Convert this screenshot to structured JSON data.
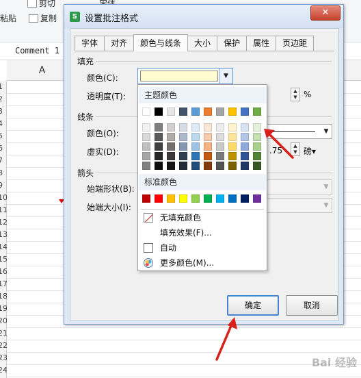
{
  "toolbar": {
    "paste_label": "粘贴",
    "copy_label": "复制",
    "cut_label": "剪切",
    "font_name": "宋体"
  },
  "formula_bar": {
    "content": "Comment 1"
  },
  "sheet": {
    "column_a": "A",
    "rows": [
      "1",
      "2",
      "3",
      "4",
      "5",
      "6",
      "7",
      "8",
      "9",
      "10",
      "11",
      "12",
      "13",
      "14",
      "15",
      "16",
      "17",
      "18",
      "19",
      "20",
      "21",
      "22",
      "23",
      "24"
    ]
  },
  "dialog": {
    "title": "设置批注格式",
    "close_symbol": "✕",
    "tabs": [
      "字体",
      "对齐",
      "颜色与线条",
      "大小",
      "保护",
      "属性",
      "页边距"
    ],
    "active_tab": "颜色与线条",
    "fill": {
      "section": "填充",
      "color_label": "颜色(C):",
      "color_value": "#fffdd0",
      "transparency_label": "透明度(T):",
      "transparency_unit": "%"
    },
    "line": {
      "section": "线条",
      "color_label": "颜色(O):",
      "dash_label": "虚实(D):",
      "weight_value": ".75",
      "weight_unit": "磅▾"
    },
    "arrows": {
      "section": "箭头",
      "begin_style_label": "始端形状(B):",
      "begin_size_label": "始端大小(I):"
    },
    "ok_label": "确定",
    "cancel_label": "取消"
  },
  "color_dropdown": {
    "theme_header": "主题颜色",
    "standard_header": "标准颜色",
    "theme_top_row": [
      "#ffffff",
      "#000000",
      "#e7e6e6",
      "#44546a",
      "#5b9bd5",
      "#ed7d31",
      "#a5a5a5",
      "#ffc000",
      "#4472c4",
      "#70ad47"
    ],
    "theme_shades": [
      [
        "#f2f2f2",
        "#808080",
        "#d0cece",
        "#d6dce4",
        "#deebf6",
        "#fbe5d5",
        "#ededed",
        "#fff2cc",
        "#d9e2f3",
        "#e2efd9"
      ],
      [
        "#d9d9d9",
        "#595959",
        "#aeaaaa",
        "#adb9ca",
        "#bdd7ee",
        "#f7cbac",
        "#dbdbdb",
        "#fee599",
        "#b4c6e7",
        "#c5e0b3"
      ],
      [
        "#bfbfbf",
        "#404040",
        "#757070",
        "#8496b0",
        "#9cc3e5",
        "#f4b183",
        "#c9c9c9",
        "#ffd965",
        "#8eaadb",
        "#a8d08d"
      ],
      [
        "#a6a6a6",
        "#262626",
        "#3a3838",
        "#323f4f",
        "#2e75b5",
        "#c55a11",
        "#7b7b7b",
        "#bf9000",
        "#2f5496",
        "#538135"
      ],
      [
        "#7f7f7f",
        "#0d0d0d",
        "#161616",
        "#222a35",
        "#1e4e79",
        "#833c0b",
        "#525252",
        "#7f6000",
        "#1f3864",
        "#375623"
      ]
    ],
    "standard_colors": [
      "#c00000",
      "#ff0000",
      "#ffc000",
      "#ffff00",
      "#92d050",
      "#00b050",
      "#00b0f0",
      "#0070c0",
      "#002060",
      "#7030a0"
    ],
    "no_fill_label": "无填充颜色",
    "fill_effects_label": "填充效果(F)...",
    "automatic_label": "自动",
    "more_colors_label": "更多颜色(M)..."
  },
  "watermark": {
    "text": "Bai 经验"
  }
}
